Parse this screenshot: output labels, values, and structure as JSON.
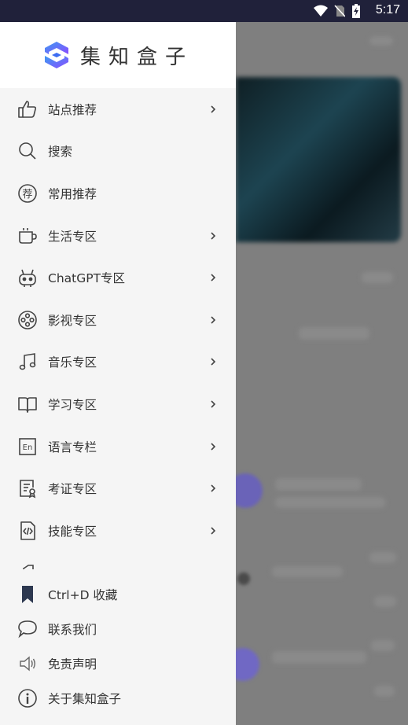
{
  "status_bar": {
    "time": "5:17"
  },
  "app": {
    "title": "集知盒子"
  },
  "menu": [
    {
      "label": "站点推荐",
      "icon": "thumbs-up-icon",
      "chevron": true
    },
    {
      "label": "搜索",
      "icon": "search-icon",
      "chevron": false
    },
    {
      "label": "常用推荐",
      "icon": "recommend-badge-icon",
      "chevron": false
    },
    {
      "label": "生活专区",
      "icon": "cup-icon",
      "chevron": true
    },
    {
      "label": "ChatGPT专区",
      "icon": "robot-icon",
      "chevron": true
    },
    {
      "label": "影视专区",
      "icon": "film-reel-icon",
      "chevron": true
    },
    {
      "label": "音乐专区",
      "icon": "music-note-icon",
      "chevron": true
    },
    {
      "label": "学习专区",
      "icon": "book-icon",
      "chevron": true
    },
    {
      "label": "语言专栏",
      "icon": "language-en-icon",
      "chevron": true
    },
    {
      "label": "考证专区",
      "icon": "certificate-icon",
      "chevron": true
    },
    {
      "label": "技能专区",
      "icon": "code-file-icon",
      "chevron": true
    }
  ],
  "bottom_menu": [
    {
      "label": "Ctrl+D 收藏",
      "icon": "bookmark-icon"
    },
    {
      "label": "联系我们",
      "icon": "chat-bubble-icon"
    },
    {
      "label": "免责声明",
      "icon": "speaker-icon"
    },
    {
      "label": "关于集知盒子",
      "icon": "info-icon"
    }
  ],
  "colors": {
    "status_bar": "#20213a",
    "drawer_bg": "#f5f5f5",
    "logo_blue": "#3d6df2",
    "logo_purple": "#8a4dff"
  }
}
